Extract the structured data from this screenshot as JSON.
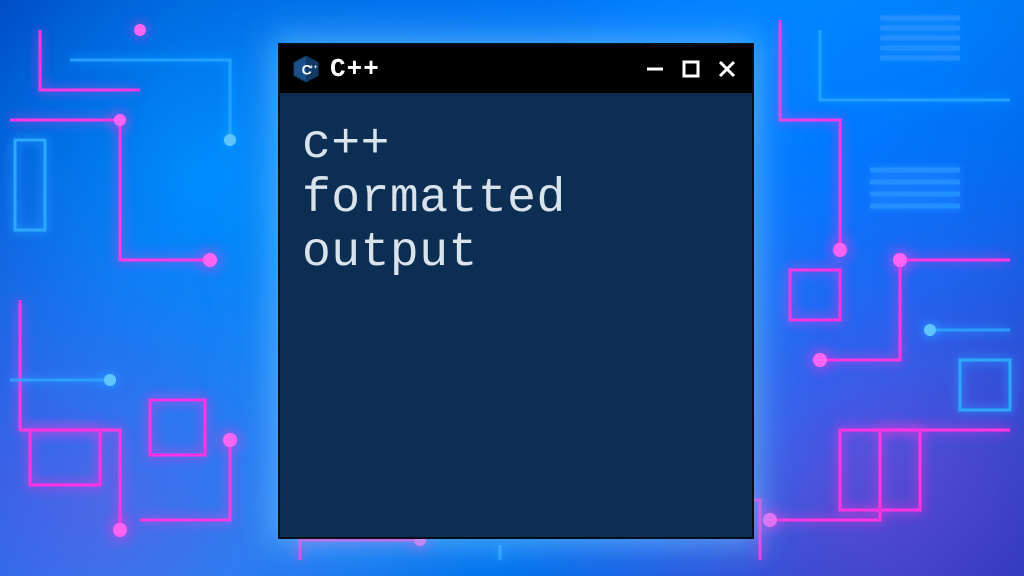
{
  "window": {
    "title": "C++",
    "logo_letter": "C",
    "logo_plus": "++",
    "controls": {
      "minimize_glyph": "—",
      "maximize_glyph": "□",
      "close_glyph": "✕"
    }
  },
  "content": {
    "lines": "c++\nformatted\noutput"
  },
  "colors": {
    "window_bg": "#0b2e52",
    "titlebar_bg": "#000000",
    "text": "#d8e3ec",
    "glow_cyan": "#3aa6ff",
    "glow_magenta": "#ff3bd4"
  }
}
